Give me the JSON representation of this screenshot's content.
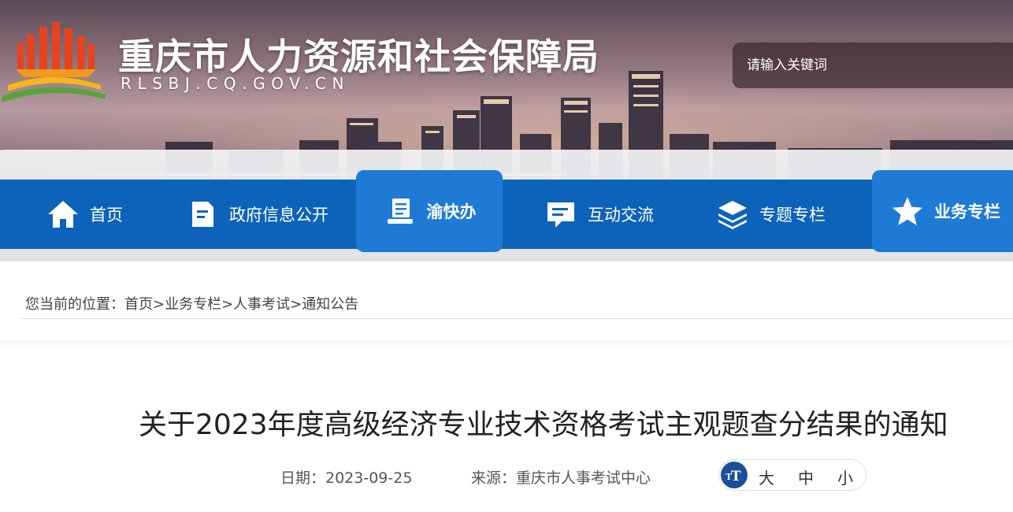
{
  "header": {
    "site_title": "重庆市人力资源和社会保障局",
    "site_domain": "RLSBJ.CQ.GOV.CN",
    "logo_icon": "government-building-logo-icon",
    "search_placeholder": "请输入关键词"
  },
  "nav": {
    "items": [
      {
        "label": "首页",
        "icon": "home-icon",
        "active": false
      },
      {
        "label": "政府信息公开",
        "icon": "document-icon",
        "active": false
      },
      {
        "label": "渝快办",
        "icon": "service-desk-icon",
        "active": true
      },
      {
        "label": "互动交流",
        "icon": "chat-icon",
        "active": false
      },
      {
        "label": "专题专栏",
        "icon": "layers-icon",
        "active": false
      },
      {
        "label": "业务专栏",
        "icon": "star-icon",
        "active": true
      }
    ],
    "bar_color": "#0d63b9",
    "active_color": "#1f7ad6"
  },
  "breadcrumb": {
    "text": "您当前的位置：首页>业务专栏>人事考试>通知公告"
  },
  "article": {
    "title": "关于2023年度高级经济专业技术资格考试主观题查分结果的通知",
    "date_label": "日期：2023-09-25",
    "source_label": "来源：重庆市人事考试中心"
  },
  "font_size": {
    "icon": "text-size-icon",
    "large": "大",
    "medium": "中",
    "small": "小"
  }
}
